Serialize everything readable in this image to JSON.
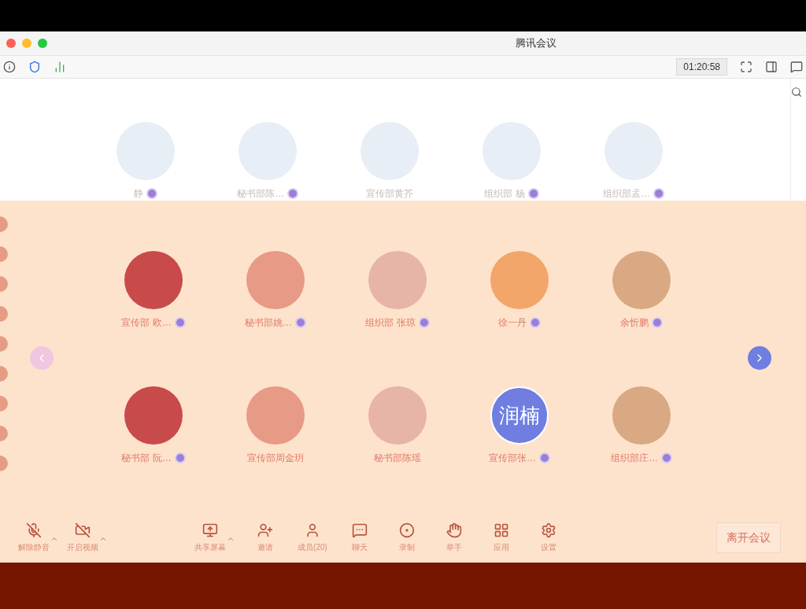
{
  "window": {
    "title": "腾讯会议"
  },
  "toolbar": {
    "timer": "01:20:58"
  },
  "top_row": [
    {
      "name": "静",
      "mic": true
    },
    {
      "name": "秘书部陈…",
      "mic": true
    },
    {
      "name": "宣传部黄芥",
      "mic": false
    },
    {
      "name": "组织部 杨",
      "mic": true
    },
    {
      "name": "组织部孟…",
      "mic": true
    }
  ],
  "grid": [
    {
      "name": "宣传部 欧…",
      "mic": true
    },
    {
      "name": "秘书部姚…",
      "mic": true
    },
    {
      "name": "组织部 张琼",
      "mic": true
    },
    {
      "name": "徐一丹",
      "mic": true
    },
    {
      "name": "余忻鹏",
      "mic": true
    },
    {
      "name": "秘书部 阮…",
      "mic": true
    },
    {
      "name": "宣传部周金玥",
      "mic": false
    },
    {
      "name": "秘书部陈瑶",
      "mic": false
    },
    {
      "name": "宣传部张…",
      "mic": true,
      "initials": "润楠"
    },
    {
      "name": "组织部庄…",
      "mic": true
    }
  ],
  "controls": [
    {
      "label": "解除静音",
      "kind": "mic",
      "caret": true
    },
    {
      "label": "开启视频",
      "kind": "video",
      "caret": true
    },
    {
      "label": "共享屏幕",
      "kind": "share",
      "caret": true
    },
    {
      "label": "邀请",
      "kind": "invite",
      "caret": false
    },
    {
      "label": "成员(20)",
      "kind": "members",
      "caret": false
    },
    {
      "label": "聊天",
      "kind": "chat",
      "caret": false
    },
    {
      "label": "录制",
      "kind": "record",
      "caret": false
    },
    {
      "label": "举手",
      "kind": "hand",
      "caret": false
    },
    {
      "label": "应用",
      "kind": "apps",
      "caret": false
    },
    {
      "label": "设置",
      "kind": "settings",
      "caret": false
    }
  ],
  "leave_button": "离开会议"
}
